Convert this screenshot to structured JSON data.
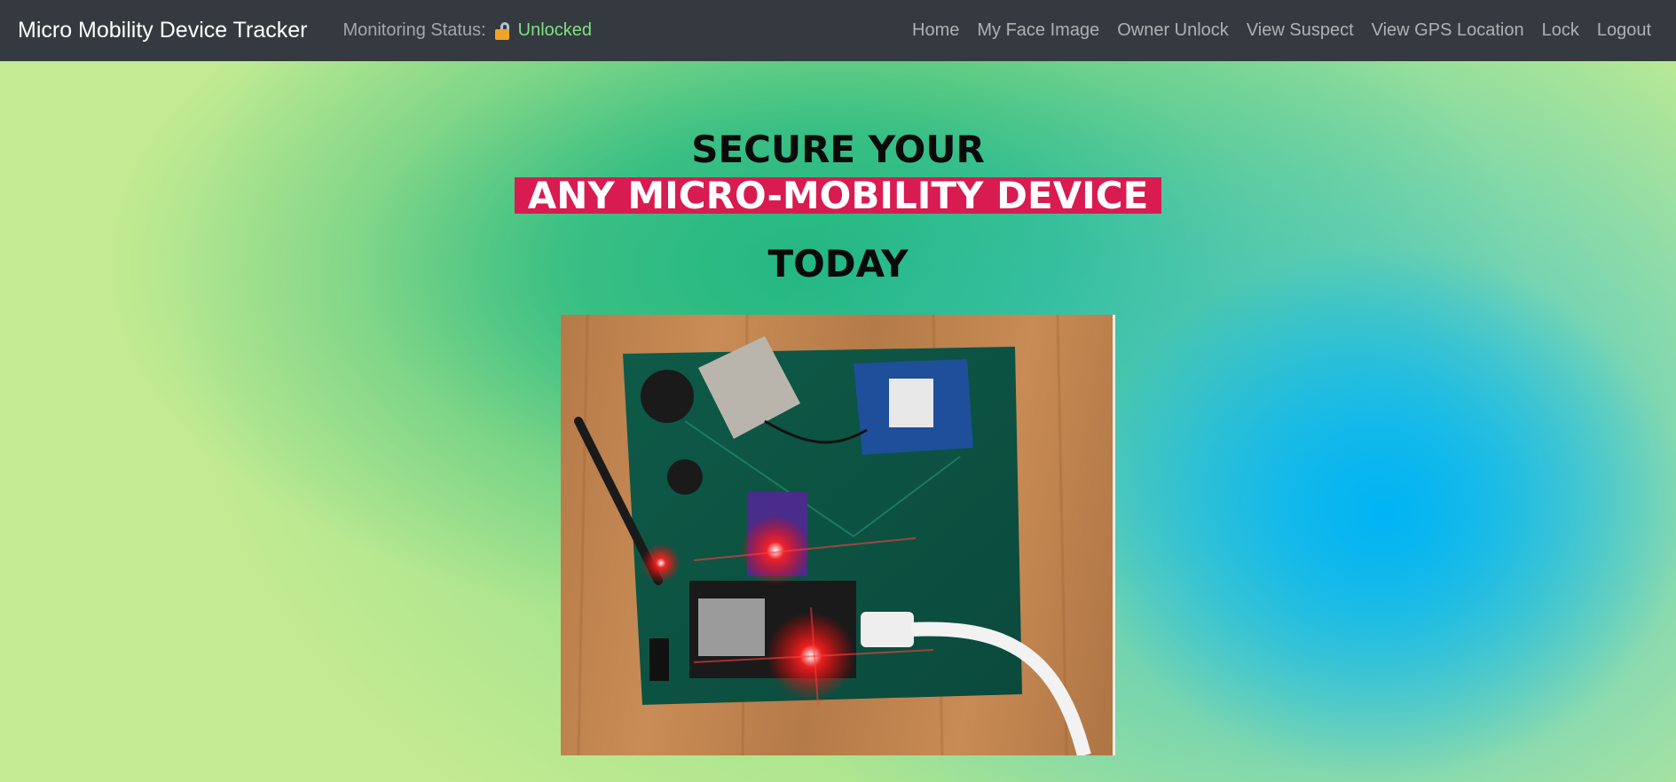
{
  "navbar": {
    "brand": "Micro Mobility Device Tracker",
    "status_label": "Monitoring Status:",
    "status_icon": "unlocked-padlock-icon",
    "status_value": "Unlocked",
    "links": [
      "Home",
      "My Face Image",
      "Owner Unlock",
      "View Suspect",
      "View GPS Location",
      "Lock",
      "Logout"
    ]
  },
  "hero": {
    "line1": "SECURE YOUR",
    "line2": "ANY MICRO-MOBILITY DEVICE",
    "line3": "TODAY"
  },
  "colors": {
    "navbar_bg": "#343a40",
    "highlight_bg": "#d81b50",
    "status_value": "#7fe07f"
  }
}
